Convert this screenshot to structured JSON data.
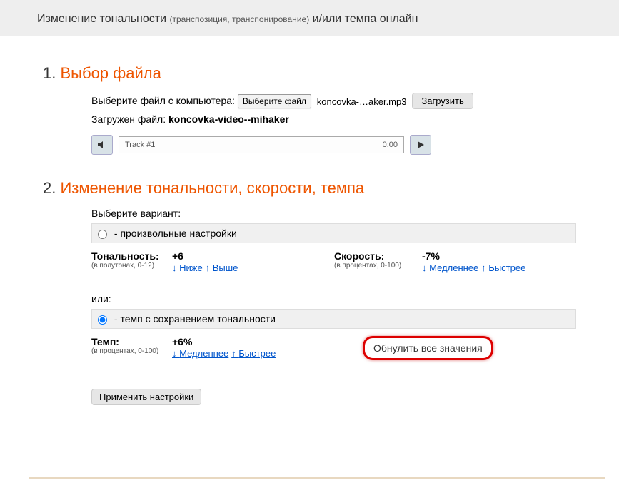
{
  "header": {
    "title_main": "Изменение тональности",
    "title_sub": "(транспозиция, транспонирование)",
    "title_end": "и/или темпа онлайн"
  },
  "section1": {
    "num": "1.",
    "title": "Выбор файла",
    "choose_label": "Выберите файл с компьютера:",
    "choose_btn": "Выберите файл",
    "file_name": "koncovka-…aker.mp3",
    "upload_btn": "Загрузить",
    "loaded_label": "Загружен файл:",
    "loaded_name": "koncovka-video--mihaker",
    "track_name": "Track #1",
    "track_time": "0:00"
  },
  "section2": {
    "num": "2.",
    "title": "Изменение тональности, скорости, темпа",
    "variant_label": "Выберите вариант:",
    "opt1_label": "- произвольные настройки",
    "pitch": {
      "label": "Тональность:",
      "hint": "(в полутонах, 0-12)",
      "value": "+6",
      "down": "Ниже",
      "up": "Выше"
    },
    "speed": {
      "label": "Скорость:",
      "hint": "(в процентах, 0-100)",
      "value": "-7%",
      "down": "Медленнее",
      "up": "Быстрее"
    },
    "or_label": "или:",
    "opt2_label": "- темп с сохранением тональности",
    "tempo": {
      "label": "Темп:",
      "hint": "(в процентах, 0-100)",
      "value": "+6%",
      "down": "Медленнее",
      "up": "Быстрее"
    },
    "reset_label": "Обнулить все значения",
    "apply_btn": "Применить настройки"
  }
}
